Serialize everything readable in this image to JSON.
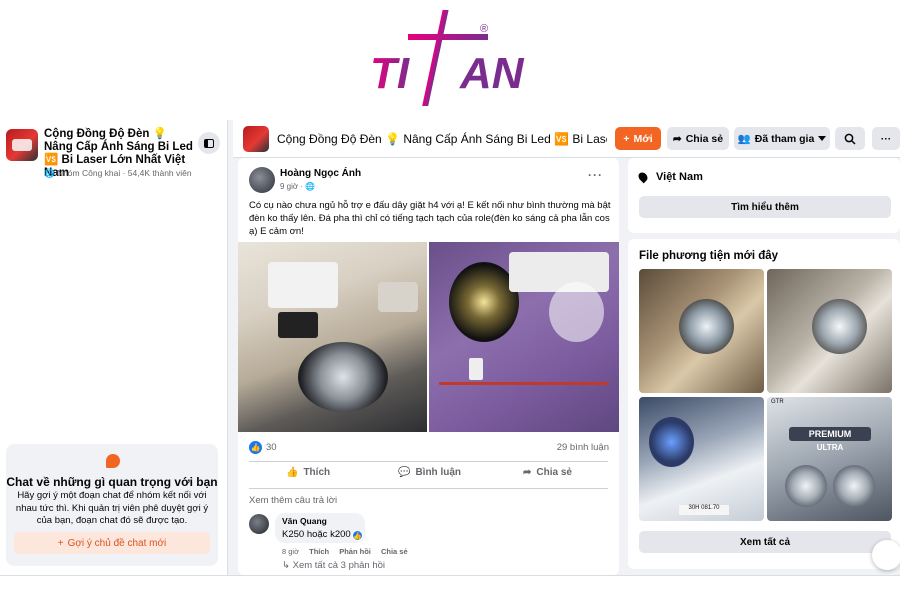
{
  "logo": {
    "text": "TITAN",
    "mark": "®",
    "colors": [
      "#e6007e",
      "#7b2c8f"
    ]
  },
  "sidebar": {
    "group_name": "Cộng Đồng Độ Đèn 💡 Nâng Cấp Ánh Sáng Bi Led 🆚 Bi Laser Lớn Nhất Việt Nam",
    "group_meta": "🌐 Nhóm Công khai · 54,4K thành viên",
    "chat": {
      "title": "Chat về những gì quan trọng với bạn",
      "desc": "Hãy gợi ý một đoạn chat để nhóm kết nối với nhau tức thì. Khi quản trị viên phê duyệt gợi ý của bạn, đoạn chat đó sẽ được tạo.",
      "button": "Gợi ý chủ đề chat mới",
      "button_icon": "+"
    }
  },
  "header": {
    "title": "Cộng Đồng Độ Đèn 💡 Nâng Cấp Ánh Sáng Bi Led 🆚 Bi Laser ...",
    "new_btn": "Mới",
    "new_icon": "+",
    "share_btn": "Chia sẻ",
    "joined_btn": "Đã tham gia",
    "more_icon": "···"
  },
  "post": {
    "author": "Hoàng Ngọc Ánh",
    "time": "9 giờ · 🌐",
    "more_icon": "···",
    "text": "Có cụ nào chưa ngủ hỗ trợ e đấu dây giặt h4 với ạ! E kết nối như bình thường mà bật đèn ko thấy lên. Đá pha thì chỉ có tiếng tạch tạch của role(đèn ko sáng cả pha lẫn cos ạ) E cảm ơn!",
    "reactions": "30",
    "comments_count": "29 bình luận",
    "actions": {
      "like": "Thích",
      "comment": "Bình luận",
      "share": "Chia sẻ"
    },
    "more_answers": "Xem thêm câu trả lời",
    "comment": {
      "name": "Văn Quang",
      "text": "K250 hoặc k200",
      "time": "8 giờ",
      "like": "Thích",
      "reply": "Phản hồi",
      "share": "Chia sẻ",
      "replies": "Xem tất cả 3 phản hồi"
    }
  },
  "right": {
    "location": "Việt Nam",
    "learn_more": "Tìm hiểu thêm",
    "media_title": "File phương tiện mới đây",
    "see_all": "Xem tất cả",
    "thumb_labels": {
      "premium": "PREMIUM",
      "ultra": "ULTRA",
      "gtr": "GTR",
      "plate": "30H 081.70"
    }
  },
  "colors": {
    "accent": "#f26522",
    "fb_blue": "#1877f2",
    "bg": "#f0f2f5"
  }
}
